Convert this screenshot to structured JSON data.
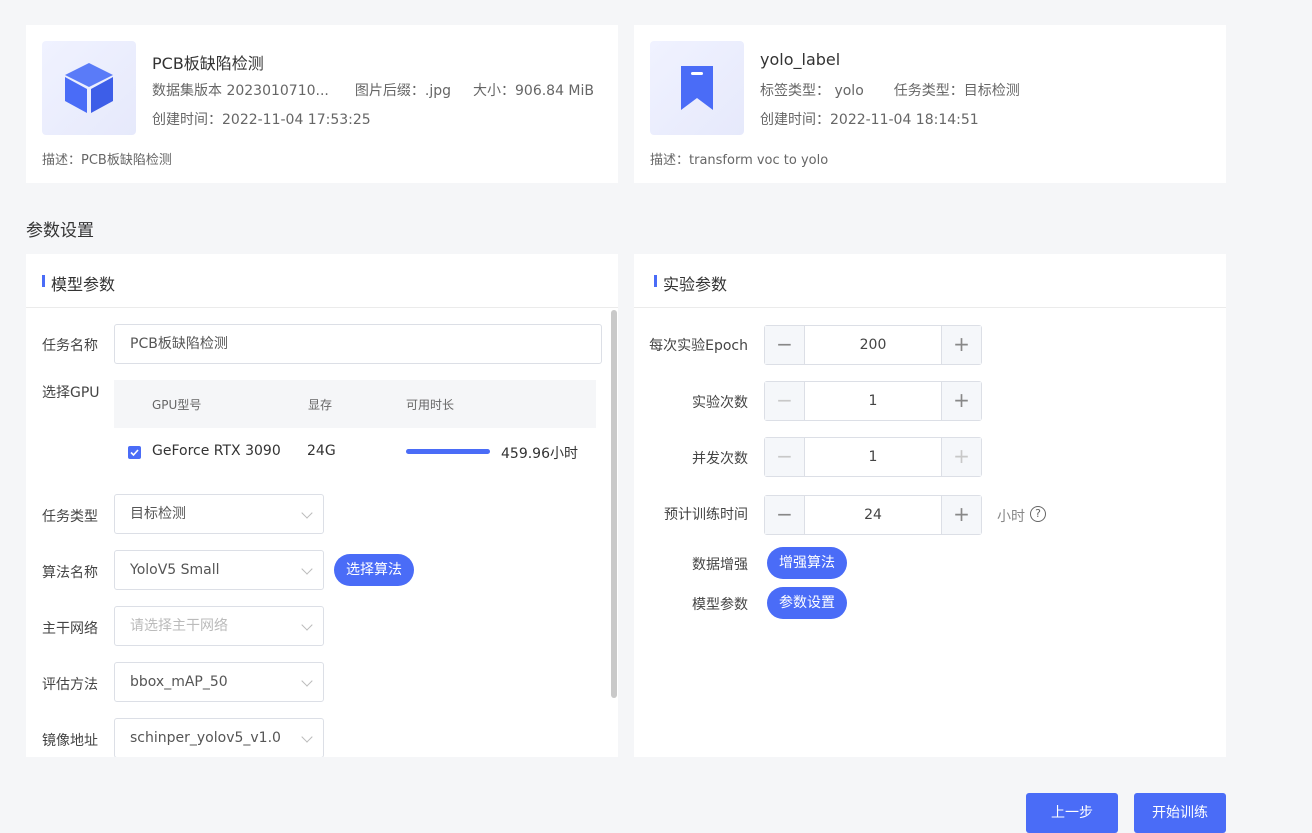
{
  "dataset": {
    "title": "PCB板缺陷检测",
    "version": "数据集版本 2023010710...",
    "suffix": "图片后缀：.jpg",
    "size": "大小：906.84 MiB",
    "created": "创建时间：2022-11-04 17:53:25",
    "desc": "描述：PCB板缺陷检测",
    "icon": "cube-icon"
  },
  "label": {
    "title": "yolo_label",
    "label_type": "标签类型： yolo",
    "task_type": "任务类型：目标检测",
    "created": "创建时间：2022-11-04 18:14:51",
    "desc": "描述：transform voc to yolo",
    "icon": "bookmark-icon"
  },
  "section_title": "参数设置",
  "model_panel": {
    "title": "模型参数",
    "task_name_label": "任务名称",
    "task_name_value": "PCB板缺陷检测",
    "gpu_label": "选择GPU",
    "gpu_columns": [
      "GPU型号",
      "显存",
      "可用时长"
    ],
    "gpu_row": {
      "model": "GeForce RTX 3090",
      "memory": "24G",
      "available": "459.96小时",
      "available_fraction": 1.0,
      "checked": true
    },
    "task_type_label": "任务类型",
    "task_type_value": "目标检测",
    "algo_label": "算法名称",
    "algo_value": "YoloV5 Small",
    "algo_button": "选择算法",
    "backbone_label": "主干网络",
    "backbone_placeholder": "请选择主干网络",
    "eval_label": "评估方法",
    "eval_value": "bbox_mAP_50",
    "image_label": "镜像地址",
    "image_value": "schinper_yolov5_v1.0"
  },
  "exp_panel": {
    "title": "实验参数",
    "epoch_label": "每次实验Epoch",
    "epoch_value": "200",
    "runs_label": "实验次数",
    "runs_value": "1",
    "concurrency_label": "并发次数",
    "concurrency_value": "1",
    "train_time_label": "预计训练时间",
    "train_time_value": "24",
    "train_time_unit": "小时",
    "augment_label": "数据增强",
    "augment_button": "增强算法",
    "model_param_label": "模型参数",
    "model_param_button": "参数设置"
  },
  "footer": {
    "prev_button": "上一步",
    "start_button": "开始训练"
  },
  "colors": {
    "accent": "#4a6cf7",
    "background": "#f5f6f8"
  }
}
